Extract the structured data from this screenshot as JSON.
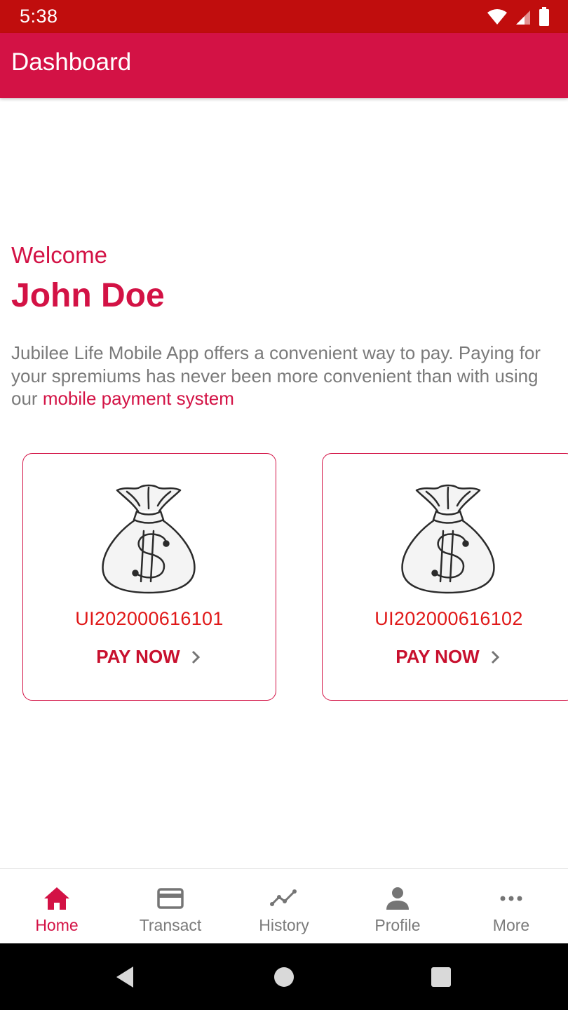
{
  "status_bar": {
    "time": "5:38",
    "icons": [
      "wifi-icon",
      "cell-signal-icon",
      "battery-icon"
    ]
  },
  "app_bar": {
    "title": "Dashboard"
  },
  "welcome": {
    "greeting": "Welcome",
    "user_name": "John Doe",
    "description_prefix": "Jubilee Life Mobile App offers a convenient way to pay. Paying for your spremiums has never been more convenient than with using our ",
    "description_link": "mobile payment system"
  },
  "policies": [
    {
      "number": "UI202000616101",
      "action": "PAY NOW",
      "icon": "money-bag-icon"
    },
    {
      "number": "UI202000616102",
      "action": "PAY NOW",
      "icon": "money-bag-icon"
    }
  ],
  "bottom_nav": {
    "items": [
      {
        "label": "Home",
        "icon": "home-icon",
        "active": true
      },
      {
        "label": "Transact",
        "icon": "card-icon",
        "active": false
      },
      {
        "label": "History",
        "icon": "history-icon",
        "active": false
      },
      {
        "label": "Profile",
        "icon": "person-icon",
        "active": false
      },
      {
        "label": "More",
        "icon": "more-icon",
        "active": false
      }
    ]
  },
  "system_nav": {
    "icons": [
      "back-icon",
      "home-circle-icon",
      "recents-icon"
    ]
  },
  "colors": {
    "status_bar": "#c00d0d",
    "primary": "#d31245",
    "policy_number": "#e01818",
    "muted_text": "#7a7a7a"
  }
}
